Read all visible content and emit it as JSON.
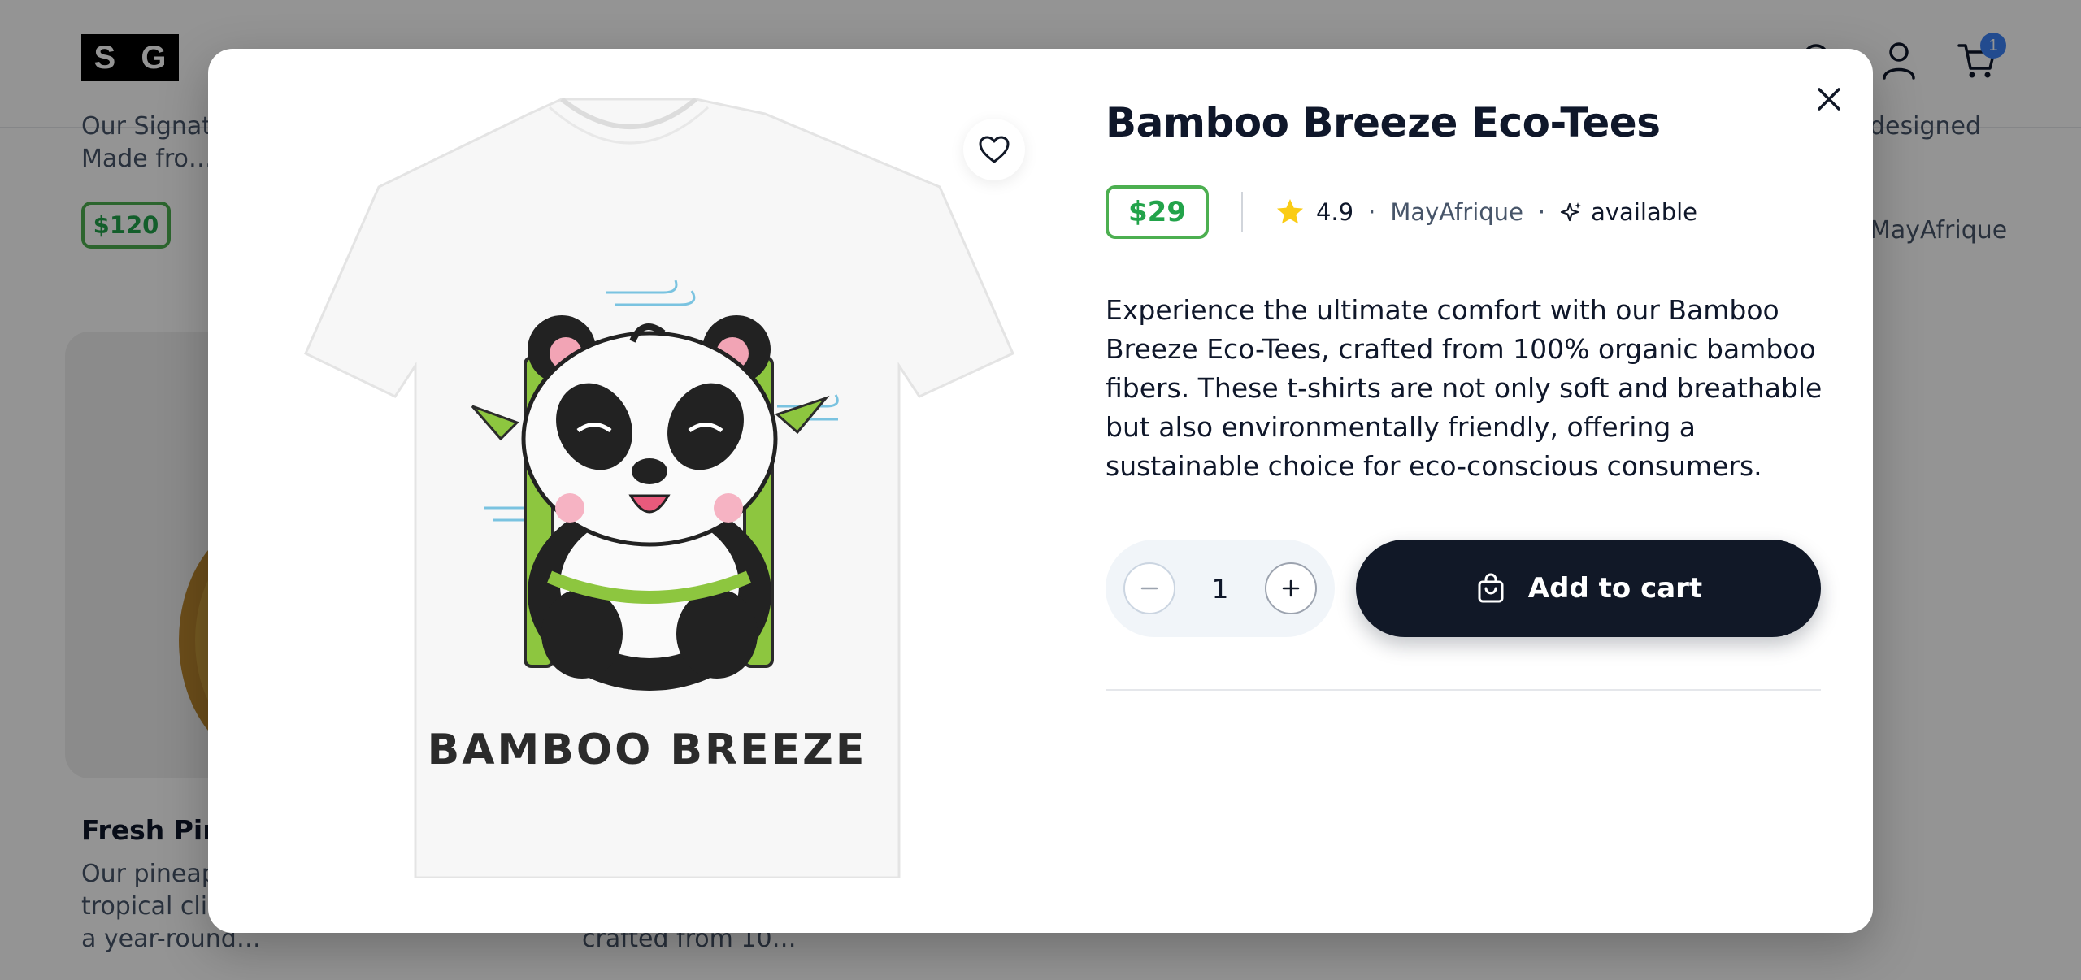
{
  "header": {
    "logo_letters": [
      "S",
      "G"
    ],
    "cart_count": "1",
    "icons": [
      "search-icon",
      "user-icon",
      "cart-icon"
    ]
  },
  "background": {
    "card1_desc_line1": "Our Signatu…",
    "card1_desc_line2": "Made fro…",
    "card1_price": "$120",
    "card2_title": "Fresh Pine…",
    "card2_desc_line1": "Our pineap…",
    "card2_desc_line2": "tropical clir…",
    "card2_desc_line3": "a year-round…",
    "card3_desc_line": "crafted from 10…",
    "right_desc_line": "designed",
    "right_brand": "MayAfrique"
  },
  "product": {
    "title": "Bamboo Breeze Eco-Tees",
    "price": "$29",
    "rating": "4.9",
    "brand": "MayAfrique",
    "availability": "available",
    "description": "Experience the ultimate comfort with our Bamboo Breeze Eco-Tees, crafted from 100% organic bamboo fibers. These t-shirts are not only soft and breathable but also environmentally friendly, offering a sustainable choice for eco-conscious consumers.",
    "image_print_text": "BAMBOO BREEZE",
    "quantity": "1",
    "add_to_cart_label": "Add to cart"
  },
  "colors": {
    "accent_dark": "#111827",
    "price_green": "#22a34a",
    "star_yellow": "#facc15",
    "badge_blue": "#3b82f6"
  }
}
